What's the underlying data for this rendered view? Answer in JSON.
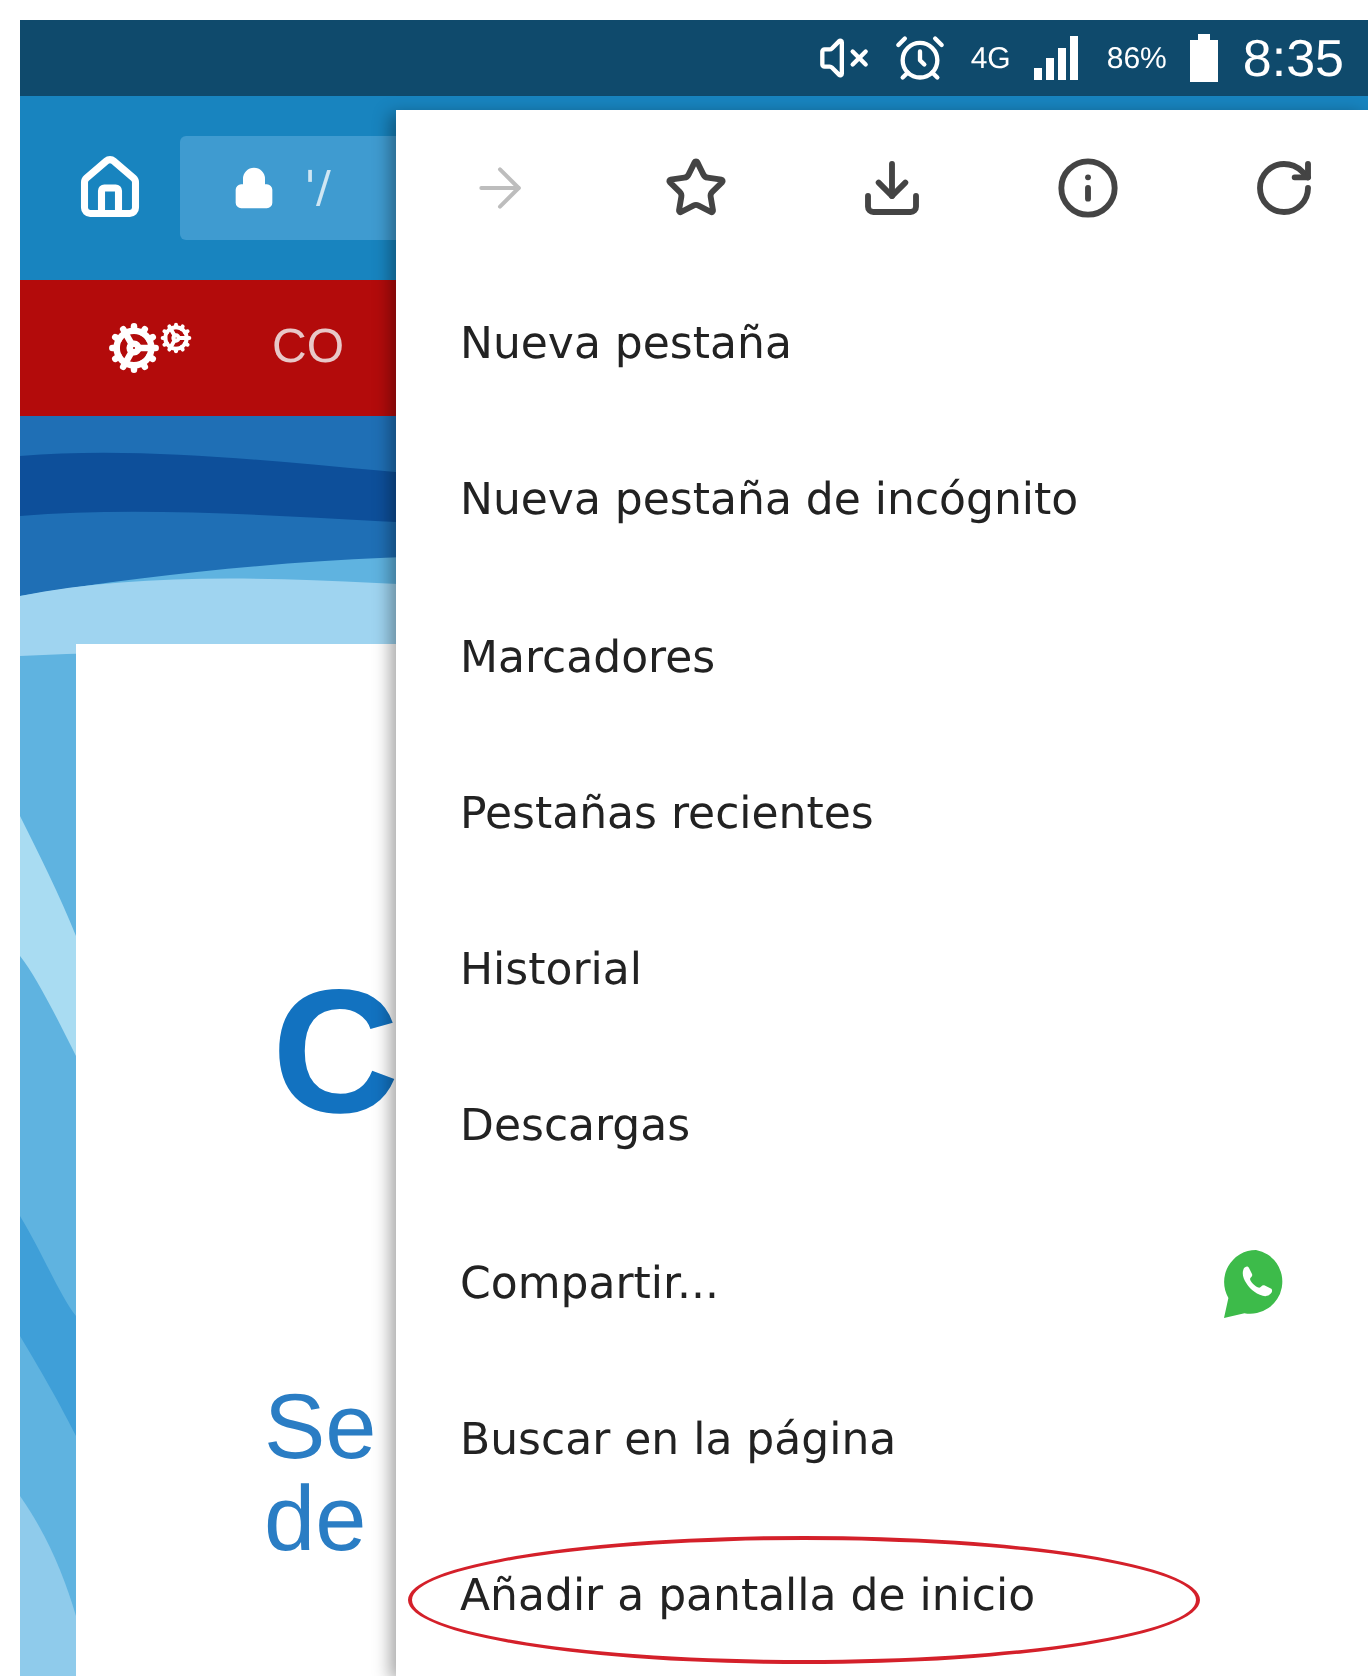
{
  "status_bar": {
    "network": "4G",
    "battery": "86%",
    "time": "8:35"
  },
  "toolbar": {
    "url": "'/"
  },
  "nav_bar": {
    "label": "CO"
  },
  "page": {
    "heading": "C",
    "subtitle_lines": [
      "Se",
      "de"
    ]
  },
  "menu": {
    "actions": [
      {
        "kind": "forward",
        "disabled": true
      },
      {
        "kind": "bookmark",
        "disabled": false
      },
      {
        "kind": "download",
        "disabled": false
      },
      {
        "kind": "info",
        "disabled": false
      },
      {
        "kind": "reload",
        "disabled": false
      }
    ],
    "items": [
      {
        "label": "Nueva pestaña",
        "kind": "plain",
        "highlighted": false
      },
      {
        "label": "Nueva pestaña de incógnito",
        "kind": "plain",
        "highlighted": false
      },
      {
        "label": "Marcadores",
        "kind": "plain",
        "highlighted": false
      },
      {
        "label": "Pestañas recientes",
        "kind": "plain",
        "highlighted": false
      },
      {
        "label": "Historial",
        "kind": "plain",
        "highlighted": false
      },
      {
        "label": "Descargas",
        "kind": "plain",
        "highlighted": false
      },
      {
        "label": "Compartir...",
        "kind": "share",
        "highlighted": false
      },
      {
        "label": "Buscar en la página",
        "kind": "plain",
        "highlighted": false
      },
      {
        "label": "Añadir a pantalla de inicio",
        "kind": "plain",
        "highlighted": true
      }
    ]
  }
}
